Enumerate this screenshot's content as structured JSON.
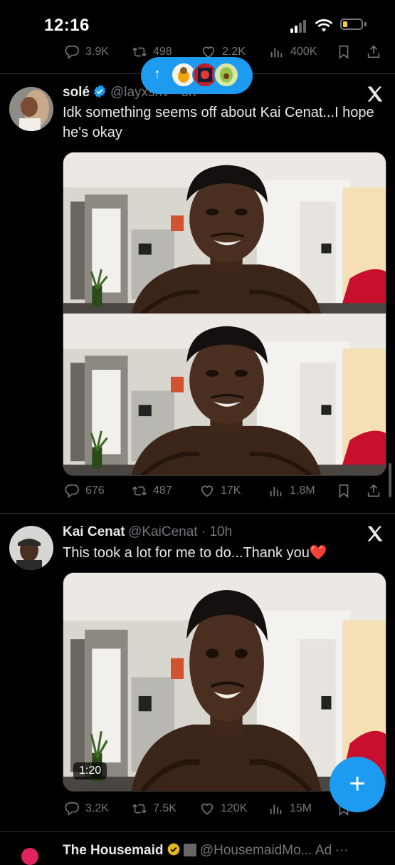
{
  "status_bar": {
    "time": "12:16"
  },
  "new_posts_pill": {
    "icon": "arrow-up"
  },
  "prev_tweet": {
    "replies": "3.9K",
    "retweets": "498",
    "likes": "2.2K",
    "views": "400K"
  },
  "tweet1": {
    "name": "solé",
    "handle": "@layxsriv · 8h",
    "text": "Idk something seems off about Kai Cenat...I hope he's okay",
    "replies": "676",
    "retweets": "487",
    "likes": "17K",
    "views": "1.8M"
  },
  "tweet2": {
    "name": "Kai Cenat",
    "handle": "@KaiCenat · 10h",
    "text": "This took a lot for me to do...Thank you",
    "heart_emoji": "❤️",
    "video_duration": "1:20",
    "replies": "3.2K",
    "retweets": "7.5K",
    "likes": "120K",
    "views": "15M"
  },
  "ad_tweet": {
    "name": "The Housemaid",
    "handle": "@HousemaidMo...",
    "ad_label": "Ad",
    "more": "···"
  },
  "fab": {
    "label": "+"
  },
  "colors": {
    "accent": "#1d9bf0",
    "muted": "#71767b",
    "background": "#000000",
    "heart": "#e0245e"
  }
}
